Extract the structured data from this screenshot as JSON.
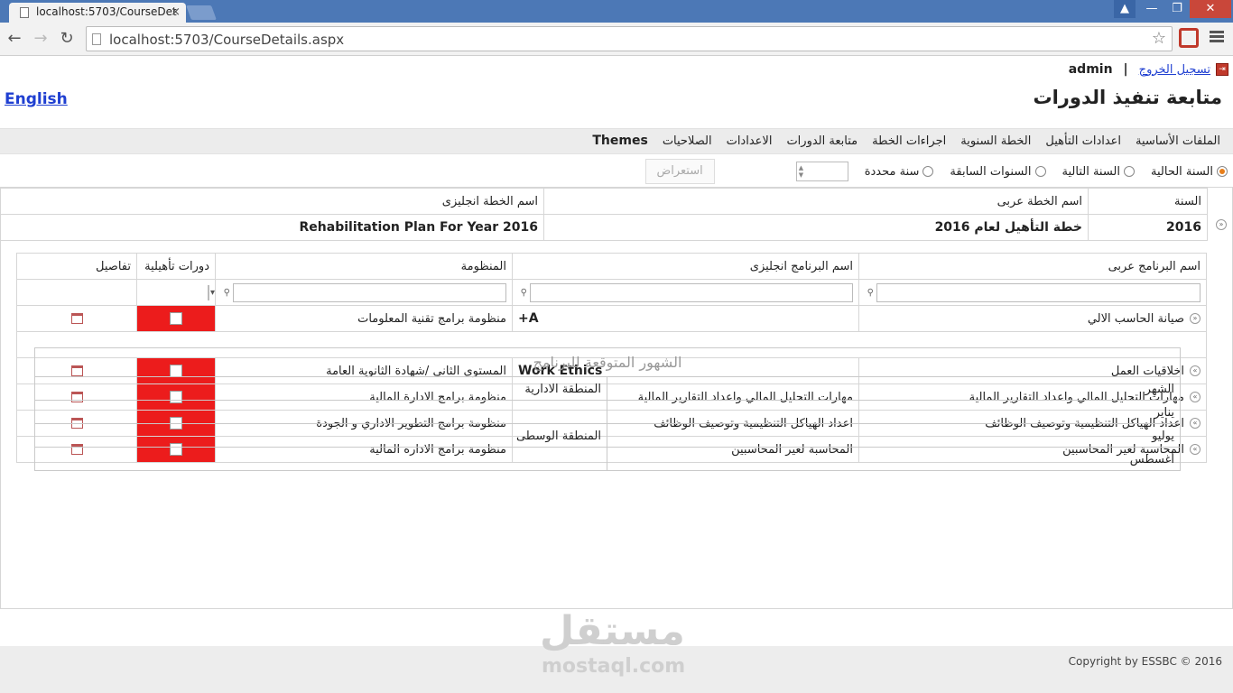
{
  "browser": {
    "tab_title": "localhost:5703/CourseDet",
    "url": "localhost:5703/CourseDetails.aspx",
    "win_user": "▲",
    "win_min": "—",
    "win_max": "❐",
    "win_close": "✕"
  },
  "header": {
    "logout": "تسجيل الخروج",
    "separator": "|",
    "user": "admin",
    "title": "متابعة تنفيذ الدورات",
    "language": "English"
  },
  "menu": [
    "الملفات الأساسية",
    "اعدادات التأهيل",
    "الخطة السنوية",
    "اجراءات الخطة",
    "متابعة الدورات",
    "الاعدادات",
    "الصلاحيات",
    "Themes"
  ],
  "year_filter": {
    "options": [
      "السنة الحالية",
      "السنة التالية",
      "السنوات السابقة",
      "سنة محددة"
    ],
    "selected": "السنة الحالية",
    "show_button": "استعراض"
  },
  "plan": {
    "headers": [
      "السنة",
      "اسم الخطة عربى",
      "اسم الخطة انجليزى"
    ],
    "year": "2016",
    "name_ar": "خطة التأهيل لعام 2016",
    "name_en": "Rehabilitation Plan For Year 2016"
  },
  "programs": {
    "headers": [
      "اسم البرنامج عربى",
      "اسم البرنامج انجليزى",
      "المنظومة",
      "دورات تأهيلية",
      "تفاصيل"
    ],
    "rows": [
      {
        "name_ar": "صيانة الحاسب الالي",
        "name_en": "A+",
        "system": "منظومة برامج تقنية المعلومات"
      },
      {
        "name_ar": "اخلاقيات العمل",
        "name_en": "Work Ethics",
        "system": "المستوى الثاني /شهادة الثانوية العامة"
      },
      {
        "name_ar": "مهارات التحليل المالي واعداد التقارير المالية",
        "name_en": "مهارات التحليل المالي واعداد التقارير المالية",
        "system": "منظومة برامج الادارة المالية"
      },
      {
        "name_ar": "اعداد الهياكل التنظيمية وتوصيف الوظائف",
        "name_en": "اعداد الهياكل التنظيمية وتوصيف الوظائف",
        "system": "منظومة برامج التطوير الاداري و الجودة"
      },
      {
        "name_ar": "المحاسبة لغير المحاسبين",
        "name_en": "المحاسبة لغير المحاسبين",
        "system": "منظومة برامج الادارة المالية"
      }
    ]
  },
  "months_detail": {
    "caption": "الشهور المتوقعة للبرنامج",
    "headers": [
      "الشهر",
      "المنطقة الادارية"
    ],
    "rows": [
      {
        "month": "يناير",
        "region": ""
      },
      {
        "month": "يوليو",
        "region": "المنطقة الوسطى"
      },
      {
        "month": "أغسطس",
        "region": ""
      }
    ]
  },
  "footer": {
    "copyright": "Copyright by ESSBC © 2016"
  },
  "watermark": {
    "ar": "مستقل",
    "en": "mostaql.com"
  }
}
